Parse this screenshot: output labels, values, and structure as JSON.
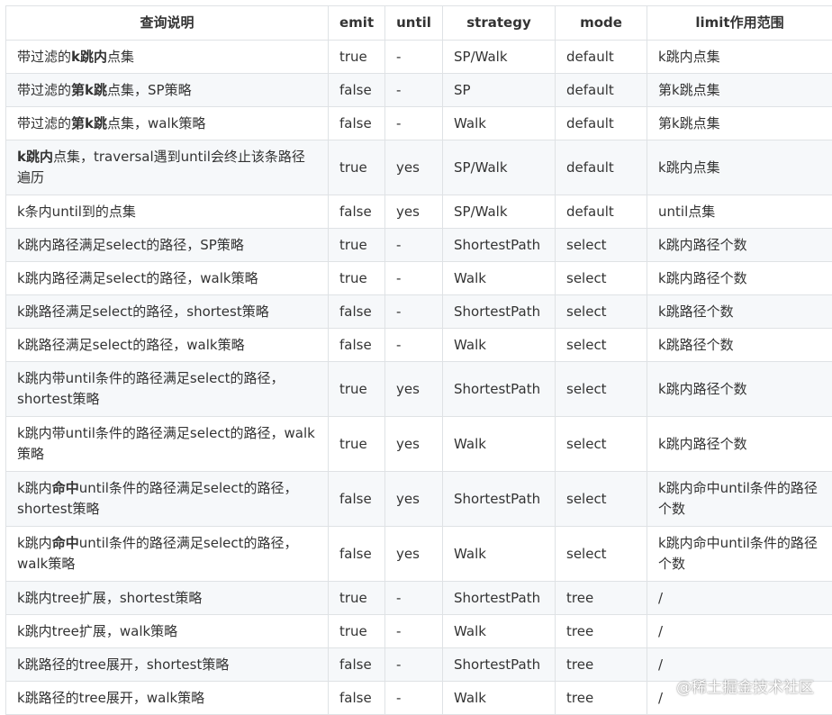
{
  "table": {
    "headers": [
      "查询说明",
      "emit",
      "until",
      "strategy",
      "mode",
      "limit作用范围"
    ],
    "rows": [
      {
        "desc": [
          {
            "t": "带过滤的"
          },
          {
            "t": "k跳内",
            "b": true
          },
          {
            "t": "点集"
          }
        ],
        "emit": "true",
        "until": "-",
        "strategy": "SP/Walk",
        "mode": "default",
        "limit": "k跳内点集"
      },
      {
        "desc": [
          {
            "t": "带过滤的"
          },
          {
            "t": "第k跳",
            "b": true
          },
          {
            "t": "点集，SP策略"
          }
        ],
        "emit": "false",
        "until": "-",
        "strategy": "SP",
        "mode": "default",
        "limit": "第k跳点集"
      },
      {
        "desc": [
          {
            "t": "带过滤的"
          },
          {
            "t": "第k跳",
            "b": true
          },
          {
            "t": "点集，walk策略"
          }
        ],
        "emit": "false",
        "until": "-",
        "strategy": "Walk",
        "mode": "default",
        "limit": "第k跳点集"
      },
      {
        "tall": true,
        "desc": [
          {
            "t": "k跳内",
            "b": true
          },
          {
            "t": "点集，traversal遇到until会终止该条路径遍历"
          }
        ],
        "emit": "true",
        "until": "yes",
        "strategy": "SP/Walk",
        "mode": "default",
        "limit": "k跳内点集"
      },
      {
        "desc": [
          {
            "t": "k条内until到的点集"
          }
        ],
        "emit": "false",
        "until": "yes",
        "strategy": "SP/Walk",
        "mode": "default",
        "limit": "until点集"
      },
      {
        "desc": [
          {
            "t": "k跳内路径满足select的路径，SP策略"
          }
        ],
        "emit": "true",
        "until": "-",
        "strategy": "ShortestPath",
        "mode": "select",
        "limit": "k跳内路径个数"
      },
      {
        "desc": [
          {
            "t": "k跳内路径满足select的路径，walk策略"
          }
        ],
        "emit": "true",
        "until": "-",
        "strategy": "Walk",
        "mode": "select",
        "limit": "k跳内路径个数"
      },
      {
        "desc": [
          {
            "t": "k跳路径满足select的路径，shortest策略"
          }
        ],
        "emit": "false",
        "until": "-",
        "strategy": "ShortestPath",
        "mode": "select",
        "limit": "k跳路径个数"
      },
      {
        "desc": [
          {
            "t": "k跳路径满足select的路径，walk策略"
          }
        ],
        "emit": "false",
        "until": "-",
        "strategy": "Walk",
        "mode": "select",
        "limit": "k跳路径个数"
      },
      {
        "tall": true,
        "desc": [
          {
            "t": "k跳内带until条件的路径满足select的路径，shortest策略"
          }
        ],
        "emit": "true",
        "until": "yes",
        "strategy": "ShortestPath",
        "mode": "select",
        "limit": "k跳内路径个数"
      },
      {
        "tall": true,
        "desc": [
          {
            "t": "k跳内带until条件的路径满足select的路径，walk策略"
          }
        ],
        "emit": "true",
        "until": "yes",
        "strategy": "Walk",
        "mode": "select",
        "limit": "k跳内路径个数"
      },
      {
        "tall": true,
        "desc": [
          {
            "t": "k跳内"
          },
          {
            "t": "命中",
            "b": true
          },
          {
            "t": "until条件的路径满足select的路径，shortest策略"
          }
        ],
        "emit": "false",
        "until": "yes",
        "strategy": "ShortestPath",
        "mode": "select",
        "limit": "k跳内命中until条件的路径个数"
      },
      {
        "tall": true,
        "desc": [
          {
            "t": "k跳内"
          },
          {
            "t": "命中",
            "b": true
          },
          {
            "t": "until条件的路径满足select的路径，walk策略"
          }
        ],
        "emit": "false",
        "until": "yes",
        "strategy": "Walk",
        "mode": "select",
        "limit": "k跳内命中until条件的路径个数"
      },
      {
        "desc": [
          {
            "t": "k跳内tree扩展，shortest策略"
          }
        ],
        "emit": "true",
        "until": "-",
        "strategy": "ShortestPath",
        "mode": "tree",
        "limit": "/"
      },
      {
        "desc": [
          {
            "t": "k跳内tree扩展，walk策略"
          }
        ],
        "emit": "true",
        "until": "-",
        "strategy": "Walk",
        "mode": "tree",
        "limit": "/"
      },
      {
        "desc": [
          {
            "t": "k跳路径的tree展开，shortest策略"
          }
        ],
        "emit": "false",
        "until": "-",
        "strategy": "ShortestPath",
        "mode": "tree",
        "limit": "/"
      },
      {
        "desc": [
          {
            "t": "k跳路径的tree展开，walk策略"
          }
        ],
        "emit": "false",
        "until": "-",
        "strategy": "Walk",
        "mode": "tree",
        "limit": "/"
      }
    ]
  },
  "watermark": "@稀土掘金技术社区"
}
